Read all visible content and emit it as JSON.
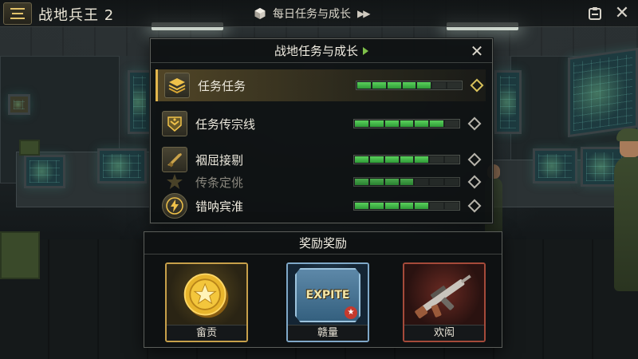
{
  "header": {
    "title": "战地兵王 2",
    "quest_label": "每日任务与成长"
  },
  "panel": {
    "title": "战地任务与成长",
    "quests": [
      {
        "label": "任务任务",
        "progress_segments": 5,
        "total_segments": 7,
        "active": true,
        "icon": "stack-icon"
      },
      {
        "label": "任务传宗线",
        "progress_segments": 6,
        "total_segments": 7,
        "active": false,
        "icon": "rank-chevron-icon"
      },
      {
        "label": "裀屈接剔",
        "progress_segments": 5,
        "total_segments": 7,
        "active": false,
        "icon": "rifle-icon"
      },
      {
        "label": "传条定佻",
        "progress_segments": 4,
        "total_segments": 7,
        "active": false,
        "faded": true,
        "icon": "star-icon"
      },
      {
        "label": "错呐宾淮",
        "progress_segments": 5,
        "total_segments": 7,
        "active": false,
        "icon": "lightning-icon"
      }
    ]
  },
  "rewards": {
    "title": "奖励奖励",
    "items": [
      {
        "label": "畲贡",
        "icon": "gold-coin-icon"
      },
      {
        "label": "赣量",
        "icon": "expite-badge-icon",
        "badge_text": "EXPITE"
      },
      {
        "label": "欢闳",
        "icon": "assault-rifle-icon"
      }
    ]
  },
  "colors": {
    "progress": "#4cc44f",
    "accent_gold": "#e2b64d",
    "panel_bg": "#0e1112"
  }
}
